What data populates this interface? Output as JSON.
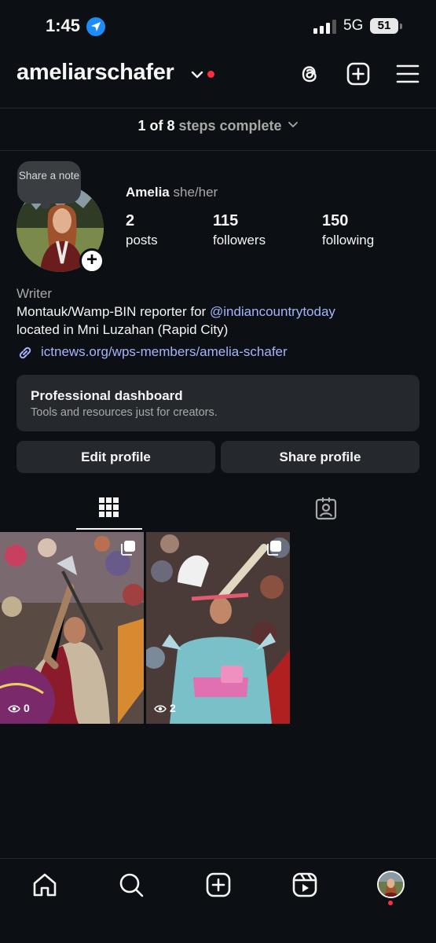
{
  "status_bar": {
    "time": "1:45",
    "network": "5G",
    "battery": "51",
    "icons": [
      "location-arrow-icon",
      "signal-bars-icon",
      "battery-icon"
    ]
  },
  "header": {
    "username": "ameliarschafer",
    "icons": [
      "chevron-down-icon",
      "threads-icon",
      "plus-square-icon",
      "menu-icon"
    ],
    "notification_color": "#ff2d3d"
  },
  "steps": {
    "count": "1 of 8",
    "label": "steps complete"
  },
  "profile": {
    "note_bubble": "Share a note",
    "name": "Amelia",
    "pronouns": "she/her",
    "stats": [
      {
        "value": "2",
        "label": "posts"
      },
      {
        "value": "115",
        "label": "followers"
      },
      {
        "value": "150",
        "label": "following"
      }
    ],
    "category": "Writer",
    "bio_line1_prefix": "Montauk/Wamp-BIN reporter for ",
    "bio_mention": "@indiancountrytoday",
    "bio_line2": "located in Mni Luzahan (Rapid City)",
    "link": "ictnews.org/wps-members/amelia-schafer"
  },
  "dashboard": {
    "title": "Professional dashboard",
    "subtitle": "Tools and resources just for creators."
  },
  "buttons": {
    "edit": "Edit profile",
    "share": "Share profile"
  },
  "tabs": [
    "grid-icon",
    "tagged-person-icon"
  ],
  "posts": [
    {
      "views": "0",
      "type": "carousel"
    },
    {
      "views": "2",
      "type": "carousel"
    }
  ],
  "bottom_nav": [
    "home-icon",
    "search-icon",
    "create-icon",
    "reels-icon",
    "profile-avatar"
  ],
  "colors": {
    "background": "#0c1014",
    "surface": "#25292e",
    "link": "#a5b4fc",
    "muted_text": "#a8a8a8",
    "accent_blue": "#1d8cf8"
  }
}
